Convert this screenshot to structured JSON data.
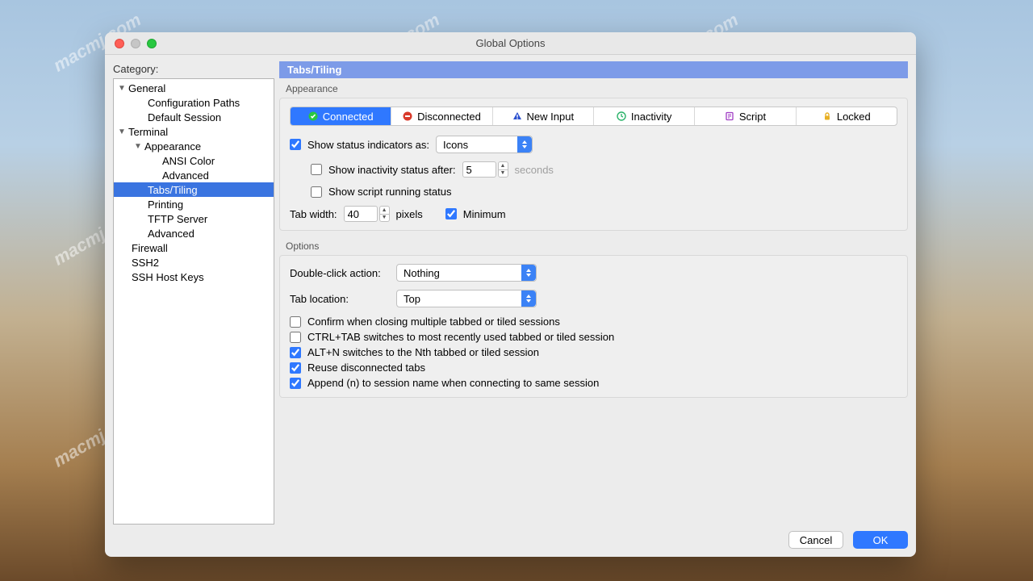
{
  "window": {
    "title": "Global Options"
  },
  "sidebar": {
    "label": "Category:",
    "items": {
      "general": "General",
      "config_paths": "Configuration Paths",
      "default_session": "Default Session",
      "terminal": "Terminal",
      "appearance": "Appearance",
      "ansi_color": "ANSI Color",
      "advanced1": "Advanced",
      "tabs_tiling": "Tabs/Tiling",
      "printing": "Printing",
      "tftp": "TFTP Server",
      "advanced2": "Advanced",
      "firewall": "Firewall",
      "ssh2": "SSH2",
      "hostkeys": "SSH Host Keys"
    }
  },
  "header": {
    "title": "Tabs/Tiling"
  },
  "appearance": {
    "label": "Appearance",
    "tabs": {
      "connected": "Connected",
      "disconnected": "Disconnected",
      "new_input": "New Input",
      "inactivity": "Inactivity",
      "script": "Script",
      "locked": "Locked"
    },
    "show_status_label": "Show status indicators as:",
    "show_status_value": "Icons",
    "inactivity_label": "Show inactivity status after:",
    "inactivity_value": "5",
    "inactivity_unit": "seconds",
    "script_running_label": "Show script running status",
    "tab_width_label": "Tab width:",
    "tab_width_value": "40",
    "tab_width_unit": "pixels",
    "minimum_label": "Minimum"
  },
  "options": {
    "label": "Options",
    "dbl_click_label": "Double-click action:",
    "dbl_click_value": "Nothing",
    "tab_location_label": "Tab location:",
    "tab_location_value": "Top",
    "confirm_close": "Confirm when closing multiple tabbed or tiled sessions",
    "ctrl_tab": "CTRL+TAB switches to most recently used tabbed or tiled session",
    "alt_n": "ALT+N switches to the Nth tabbed or tiled session",
    "reuse": "Reuse disconnected tabs",
    "append_n": "Append (n) to session name when connecting to same session"
  },
  "footer": {
    "cancel": "Cancel",
    "ok": "OK"
  },
  "watermark": "macmj.com"
}
